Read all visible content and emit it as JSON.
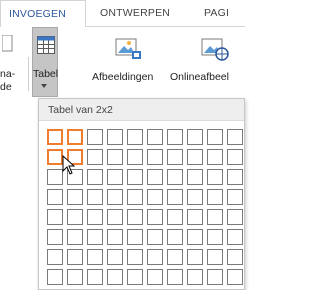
{
  "tabs": [
    {
      "label": "INVOEGEN",
      "active": true
    },
    {
      "label": "ONTWERPEN",
      "active": false
    },
    {
      "label": "PAGI",
      "active": false
    }
  ],
  "ribbon": {
    "left_partial_label_1": "na-",
    "left_partial_label_2": "de",
    "tabel_label": "Tabel",
    "afbeeldingen_label": "Afbeeldingen",
    "online_label": "Onlineafbeel"
  },
  "dropdown": {
    "header": "Tabel van 2x2",
    "columns": 10,
    "rows": 8,
    "selected_cols": 2,
    "selected_rows": 2
  },
  "colors": {
    "accent": "#2b579a",
    "selection": "#f07c2e"
  }
}
